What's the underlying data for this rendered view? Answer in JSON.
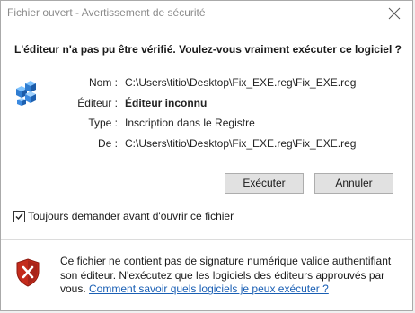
{
  "window": {
    "title": "Fichier ouvert - Avertissement de sécurité"
  },
  "question": "L'éditeur n'a pas pu être vérifié. Voulez-vous vraiment exécuter ce logiciel ?",
  "details": {
    "name_label": "Nom :",
    "name_value": "C:\\Users\\titio\\Desktop\\Fix_EXE.reg\\Fix_EXE.reg",
    "publisher_label": "Éditeur :",
    "publisher_value": "Éditeur inconnu",
    "type_label": "Type :",
    "type_value": "Inscription dans le Registre",
    "from_label": "De :",
    "from_value": "C:\\Users\\titio\\Desktop\\Fix_EXE.reg\\Fix_EXE.reg"
  },
  "buttons": {
    "run_label": "Exécuter",
    "cancel_label": "Annuler"
  },
  "checkbox": {
    "label": "Toujours demander avant d'ouvrir ce fichier",
    "checked": true
  },
  "warning": {
    "text": "Ce fichier ne contient pas de signature numérique valide authentifiant son éditeur. N'exécutez que les logiciels des éditeurs approuvés par vous. ",
    "link_text": "Comment savoir quels logiciels je peux exécuter ?"
  },
  "icons": {
    "close": "close-icon",
    "file": "registry-file-icon",
    "shield": "security-shield-icon",
    "check": "checkmark-icon"
  },
  "colors": {
    "link": "#1a5fb4",
    "shield_red": "#c42b1c",
    "title_text": "#8a8a8a"
  }
}
